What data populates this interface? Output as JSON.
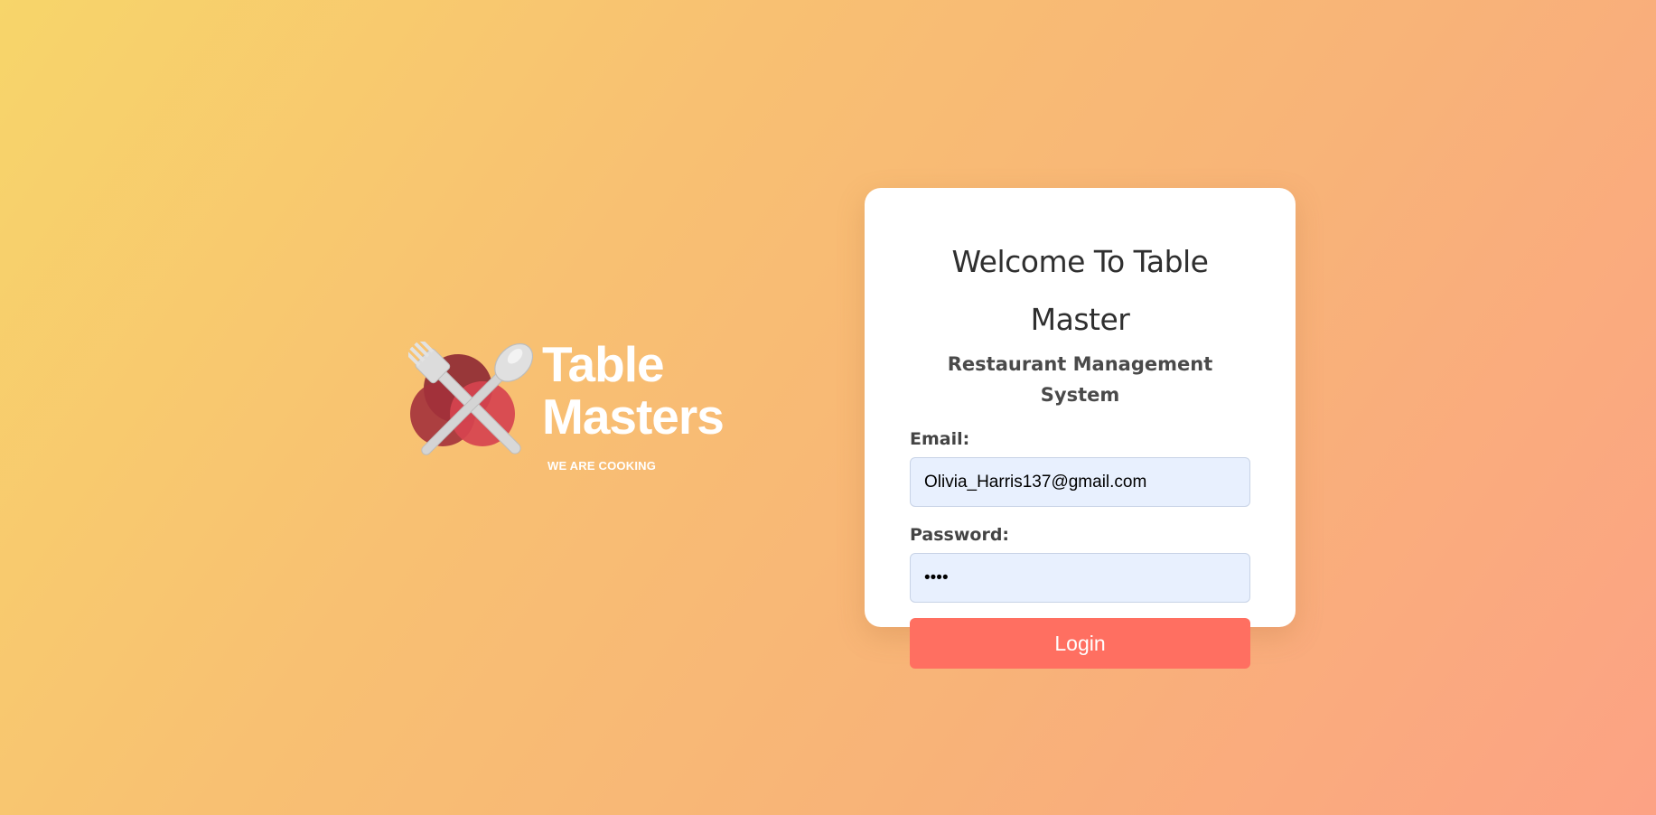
{
  "brand": {
    "title_line1": "Table",
    "title_line2": "Masters",
    "tagline": "WE ARE COOKING",
    "logo_icon": "fork-and-spoon-logo-icon"
  },
  "login": {
    "title": "Welcome To Table Master",
    "subtitle": "Restaurant Management System",
    "email_label": "Email:",
    "email_value": "Olivia_Harris137@gmail.com",
    "password_label": "Password:",
    "password_value": "1234",
    "login_button": "Login"
  },
  "colors": {
    "accent": "#ff6f61",
    "input_bg": "#e8f0fe",
    "logo_red_dark": "#8b2530",
    "logo_red": "#d2434f",
    "background_start": "#f7d56a",
    "background_end": "#fca284"
  }
}
